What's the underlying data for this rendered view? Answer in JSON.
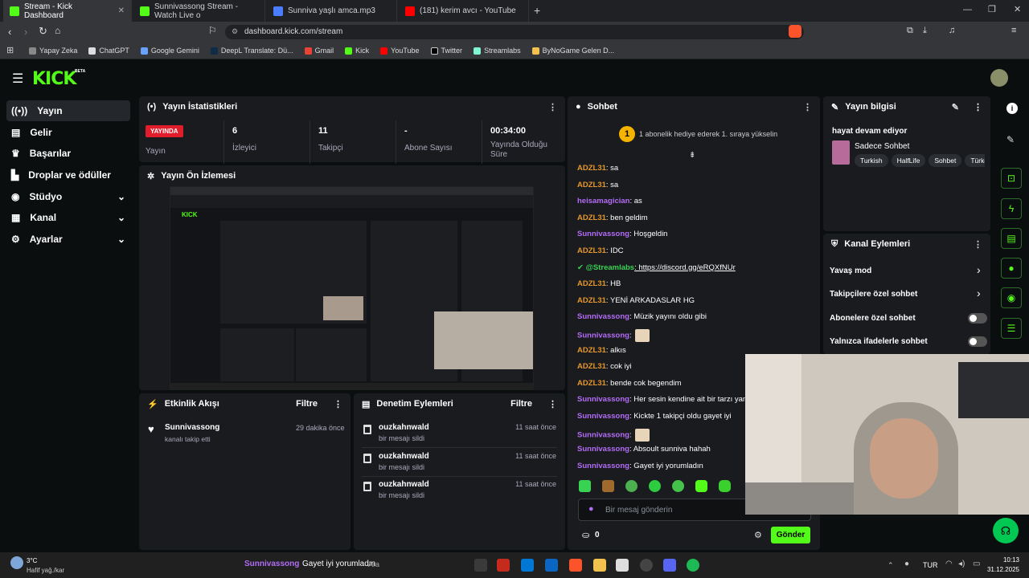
{
  "tabs": [
    {
      "label": "Stream - Kick Dashboard",
      "active": true
    },
    {
      "label": "Sunnivassong Stream - Watch Live o"
    },
    {
      "label": "Sunniva yaşlı amca.mp3"
    },
    {
      "label": "(181) kerim avcı - YouTube"
    }
  ],
  "url": "dashboard.kick.com/stream",
  "bookmarks": [
    "Yapay Zeka",
    "ChatGPT",
    "Google Gemini",
    "DeepL Translate: Dü...",
    "Gmail",
    "Kick",
    "YouTube",
    "Twitter",
    "Streamlabs",
    "ByNoGame Gelen D..."
  ],
  "brand": {
    "logo": "KICK",
    "beta": "BETA",
    "accent": "#53fc18"
  },
  "sidebar": [
    {
      "label": "Yayın",
      "icon": "broadcast-icon"
    },
    {
      "label": "Gelir",
      "icon": "revenue-icon"
    },
    {
      "label": "Başarılar",
      "icon": "trophy-icon"
    },
    {
      "label": "Droplar ve ödüller",
      "icon": "drops-icon"
    },
    {
      "label": "Stüdyo",
      "icon": "studio-icon"
    },
    {
      "label": "Kanal",
      "icon": "channel-icon"
    },
    {
      "label": "Ayarlar",
      "icon": "settings-icon"
    }
  ],
  "stats": {
    "title": "Yayın İstatistikleri",
    "live_badge": "YAYINDA",
    "live_label": "Yayın",
    "viewers": "6",
    "viewers_label": "İzleyici",
    "followers": "11",
    "followers_label": "Takipçi",
    "subs": "-",
    "subs_label": "Abone Sayısı",
    "duration": "00:34:00",
    "duration_label": "Yayında Olduğu Süre"
  },
  "preview": {
    "title": "Yayın Ön İzlemesi"
  },
  "activity": {
    "title": "Etkinlik Akışı",
    "filter": "Filtre",
    "items": [
      {
        "user": "Sunnivassong",
        "desc": "kanalı takip etti",
        "time": "29 dakika önce"
      }
    ]
  },
  "moderation": {
    "title": "Denetim Eylemleri",
    "filter": "Filtre",
    "items": [
      {
        "user": "ouzkahnwald",
        "desc": "bir mesajı sildi",
        "time": "11 saat önce"
      },
      {
        "user": "ouzkahnwald",
        "desc": "bir mesajı sildi",
        "time": "11 saat önce"
      },
      {
        "user": "ouzkahnwald",
        "desc": "bir mesajı sildi",
        "time": "11 saat önce"
      }
    ]
  },
  "chat": {
    "title": "Sohbet",
    "gift_banner": "1 abonelik hediye ederek 1. sıraya yükselin",
    "gift_count": "1",
    "messages": [
      {
        "user": "ADZL31",
        "text": ": sa",
        "color": "u1"
      },
      {
        "user": "ADZL31",
        "text": ": sa",
        "color": "u1"
      },
      {
        "user": "heisamagician",
        "text": ": as",
        "color": "u2"
      },
      {
        "user": "ADZL31",
        "text": ": ben geldim",
        "color": "u1"
      },
      {
        "user": "Sunnivassong",
        "text": ": Hoşgeldin",
        "color": "u2"
      },
      {
        "user": "ADZL31",
        "text": ": IDC",
        "color": "u1"
      },
      {
        "user": "@Streamlabs",
        "text": ": https://discord.gg/eRQXfNUr",
        "color": "u3"
      },
      {
        "user": "ADZL31",
        "text": ": HB",
        "color": "u1"
      },
      {
        "user": "ADZL31",
        "text": ": YENİ ARKADASLAR HG",
        "color": "u1"
      },
      {
        "user": "Sunnivassong",
        "text": ": Müzik yayını oldu gibi",
        "color": "u2"
      },
      {
        "user": "Sunnivassong",
        "text": ":",
        "color": "u2",
        "emote": true
      },
      {
        "user": "ADZL31",
        "text": ": alkıs",
        "color": "u1"
      },
      {
        "user": "ADZL31",
        "text": ": cok iyi",
        "color": "u1"
      },
      {
        "user": "ADZL31",
        "text": ": bende cok begendim",
        "color": "u1"
      },
      {
        "user": "Sunnivassong",
        "text": ": Her sesin kendine ait bir tarzı yani",
        "color": "u2"
      },
      {
        "user": "Sunnivassong",
        "text": ": Kickte 1 takipçi oldu gayet iyi",
        "color": "u2"
      },
      {
        "user": "Sunnivassong",
        "text": ":",
        "color": "u2",
        "emote": true
      },
      {
        "user": "Sunnivassong",
        "text": ": Absoult sunniva hahah",
        "color": "u2"
      },
      {
        "user": "Sunnivassong",
        "text": ": Gayet iyi yorumladın",
        "color": "u2"
      }
    ],
    "input_placeholder": "Bir mesaj gönderin",
    "points": "0",
    "send": "Gönder"
  },
  "stream_info": {
    "title": "Yayın bilgisi",
    "stream_title": "hayat devam ediyor",
    "category": "Sadece Sohbet",
    "tags": [
      "Turkish",
      "HalfLife",
      "Sohbet",
      "Türkç"
    ]
  },
  "channel_actions": {
    "title": "Kanal Eylemleri",
    "items": [
      {
        "label": "Yavaş mod",
        "type": "arrow"
      },
      {
        "label": "Takipçilere özel sohbet",
        "type": "arrow"
      },
      {
        "label": "Abonelere özel sohbet",
        "type": "toggle",
        "enabled": false
      },
      {
        "label": "Yalnızca ifadelerle sohbet",
        "type": "toggle",
        "enabled": false
      }
    ]
  },
  "taskbar": {
    "weather_temp": "3°C",
    "weather_desc": "Hafif yağ./kar",
    "notify_user": "Sunnivassong",
    "notify_text": "Gayet iyi yorumladın",
    "search": "Ara",
    "lang": "TUR",
    "time": "10:13",
    "date": "31.12.2025"
  }
}
